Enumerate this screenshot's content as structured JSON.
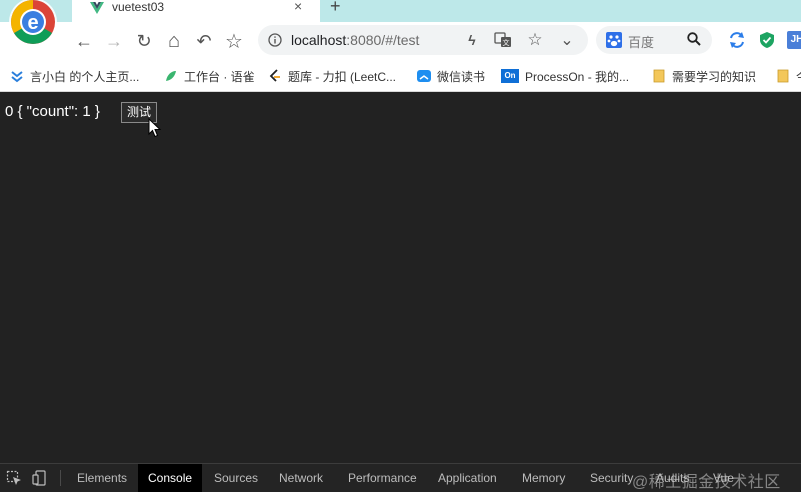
{
  "colors": {
    "tabstrip_bg": "#bde8e9",
    "page_bg": "#222222",
    "devtools_bg": "#242424",
    "vue_green": "#42b883",
    "active_tab_bg": "#000000"
  },
  "browser": {
    "logo_icon": "chrome-e-logo-icon",
    "tab": {
      "title": "vuetest03",
      "favicon": "vue-icon",
      "close_glyph": "×"
    },
    "new_tab_glyph": "+",
    "toolbar": {
      "back_glyph": "←",
      "forward_glyph": "→",
      "reload_glyph": "↻",
      "home_glyph": "⌂",
      "undo_glyph": "↶",
      "star_glyph": "☆"
    },
    "omnibox": {
      "host": "localhost",
      "path": ":8080/#/test",
      "lightning_glyph": "ϟ",
      "bookmark_glyph": "☆",
      "dropdown_glyph": "⌄"
    },
    "search": {
      "engine": "百度",
      "icon": "baidu-paw-icon"
    },
    "extensions": [
      "sync-icon",
      "shield-icon",
      "jh-extension-icon"
    ],
    "extension_labels": {
      "jh": "JH"
    }
  },
  "bookmarks": [
    {
      "label": "言小白 的个人主页...",
      "icon": "chevrons-icon"
    },
    {
      "label": "工作台 · 语雀",
      "icon": "yuque-icon"
    },
    {
      "label": "题库 - 力扣 (LeetC...",
      "icon": "leetcode-icon"
    },
    {
      "label": "微信读书",
      "icon": "weread-icon"
    },
    {
      "label": "ProcessOn - 我的...",
      "icon": "processon-icon",
      "badge": "On"
    },
    {
      "label": "需要学习的知识",
      "icon": "folder-icon"
    },
    {
      "label": "今",
      "icon": "folder-icon"
    }
  ],
  "page": {
    "output_text": "0 { \"count\": 1 }",
    "button_label": "测试"
  },
  "devtools": {
    "tabs": [
      "Elements",
      "Console",
      "Sources",
      "Network",
      "Performance",
      "Application",
      "Memory",
      "Security",
      "Audits",
      "Vue"
    ],
    "active_tab": "Console",
    "watermark": "@稀土掘金技术社区"
  }
}
